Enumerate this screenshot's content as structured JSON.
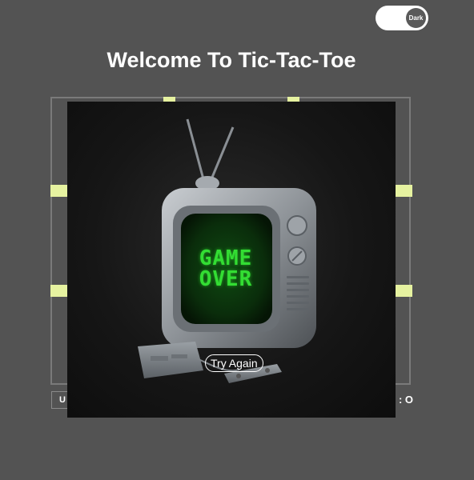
{
  "theme_toggle": {
    "label": "Dark",
    "state": "dark"
  },
  "header": {
    "title": "Welcome To Tic-Tac-Toe"
  },
  "board": {
    "accent_color": "#e6f2a0"
  },
  "status": {
    "left_label": "U",
    "right_label": ": O"
  },
  "game_over": {
    "screen_line_1": "GAME",
    "screen_line_2": "OVER",
    "try_again_label": "Try Again",
    "screen_color": "#33dd33"
  }
}
